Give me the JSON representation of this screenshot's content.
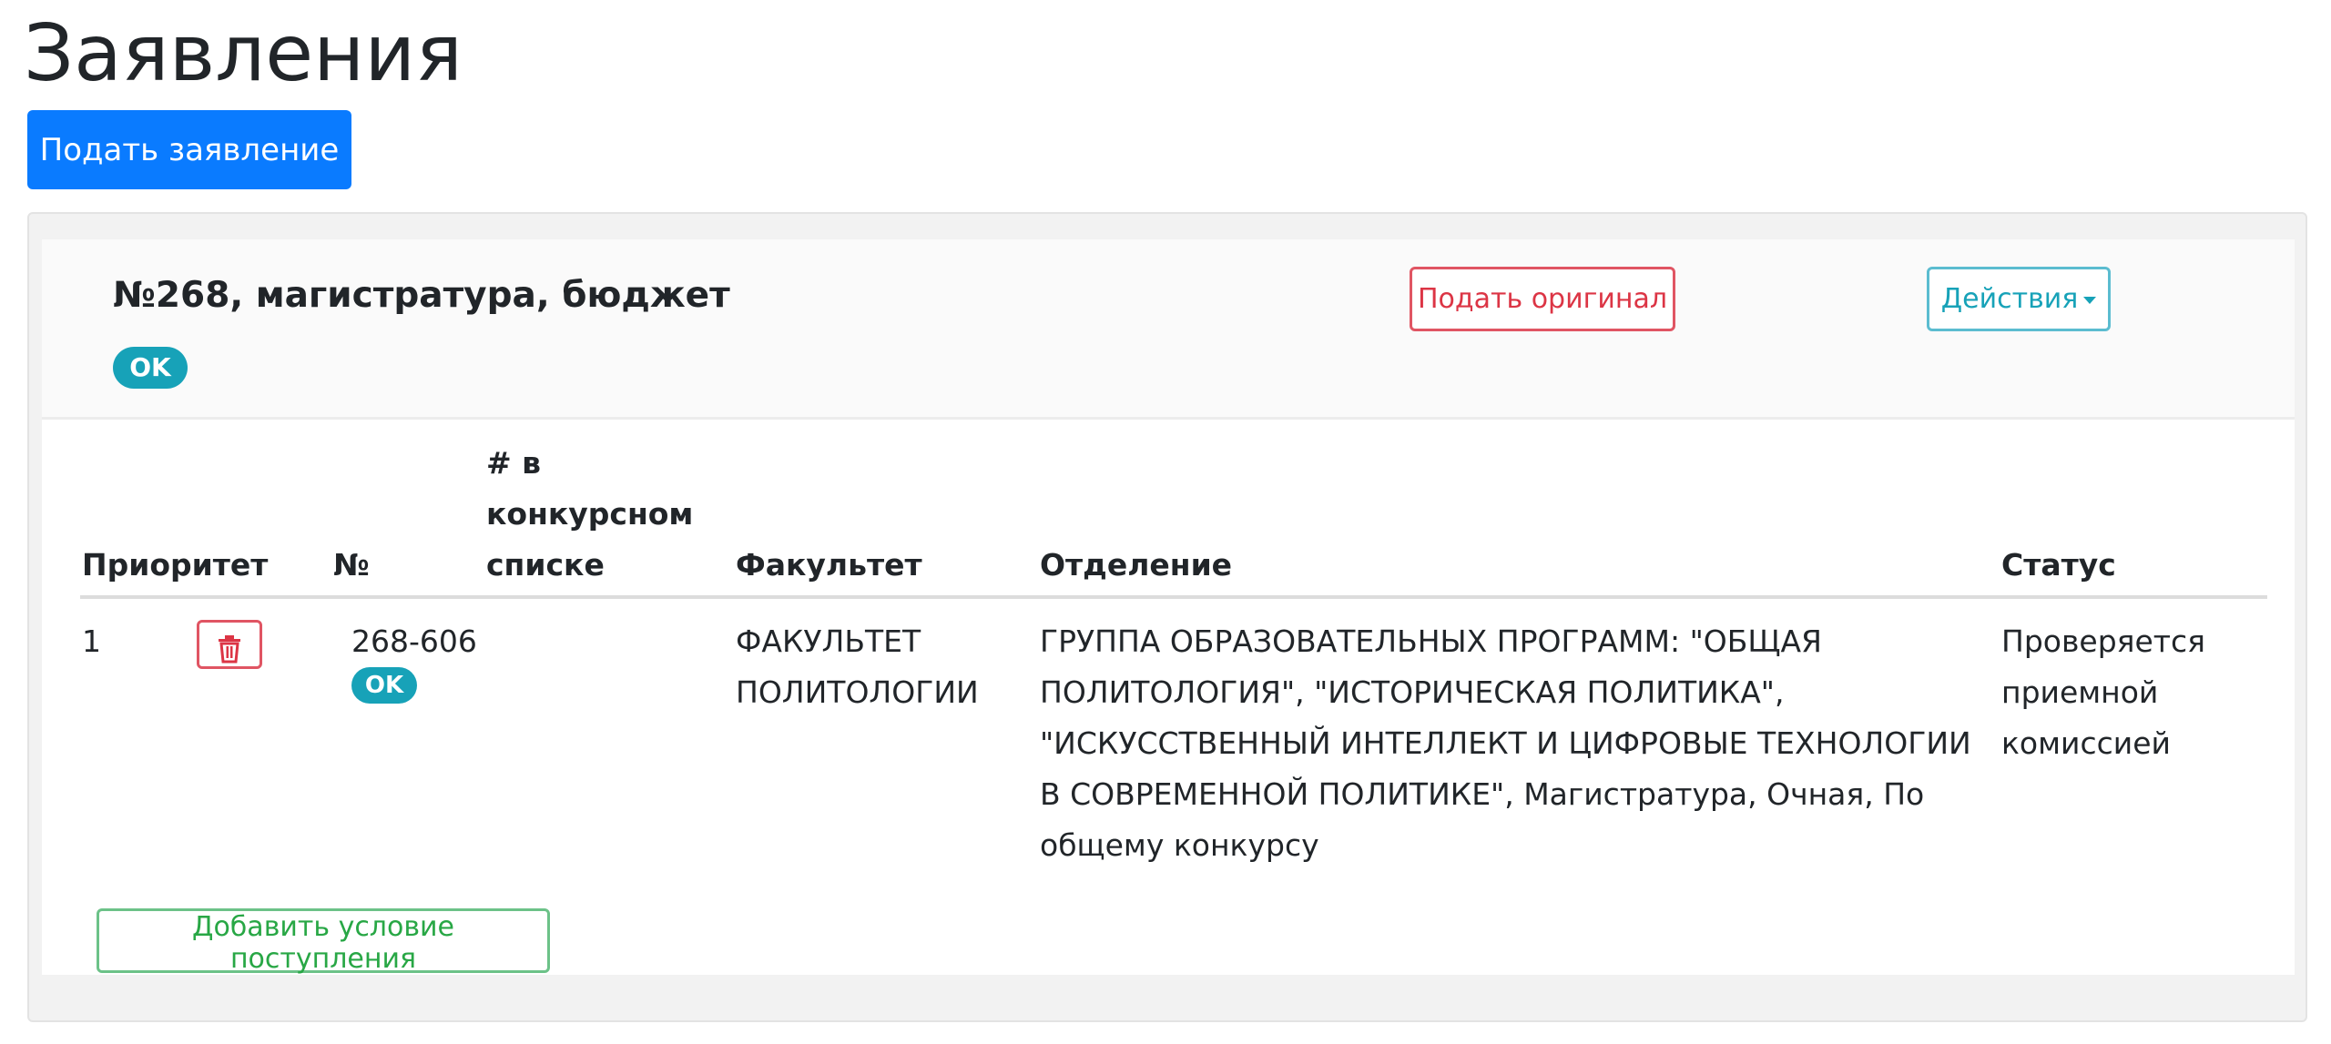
{
  "page": {
    "title": "Заявления",
    "submit_label": "Подать заявление"
  },
  "application": {
    "title": "№268, магистратура, бюджет",
    "status_badge": "OK",
    "submit_original_label": "Подать оригинал",
    "actions_label": "Действия"
  },
  "table": {
    "headers": {
      "priority": "Приоритет",
      "number": "№",
      "rank_line1": "# в",
      "rank_line2": "конкурсном",
      "rank_line3": "списке",
      "faculty": "Факультет",
      "department": "Отделение",
      "status": "Статус"
    },
    "rows": [
      {
        "priority": "1",
        "number": "268-606",
        "number_badge": "OK",
        "faculty_line1": "ФАКУЛЬТЕТ",
        "faculty_line2": "ПОЛИТОЛОГИИ",
        "department_line1": "ГРУППА ОБРАЗОВАТЕЛЬНЫХ ПРОГРАММ: \"ОБЩАЯ",
        "department_line2": "ПОЛИТОЛОГИЯ\", \"ИСТОРИЧЕСКАЯ ПОЛИТИКА\",",
        "department_line3": "\"ИСКУССТВЕННЫЙ ИНТЕЛЛЕКТ И ЦИФРОВЫЕ ТЕХНОЛОГИИ",
        "department_line4": "В СОВРЕМЕННОЙ ПОЛИТИКЕ\", Магистратура, Очная, По",
        "department_line5": "общему конкурсу",
        "status_line1": "Проверяется",
        "status_line2": "приемной",
        "status_line3": "комиссией"
      }
    ]
  },
  "add_condition_label": "Добавить условие поступления",
  "icons": {
    "delete": "trash-icon",
    "actions": "caret-down-icon"
  },
  "colors": {
    "primary": "#0a7bff",
    "danger": "#dc3545",
    "info": "#17a2b8",
    "success": "#28a745"
  }
}
